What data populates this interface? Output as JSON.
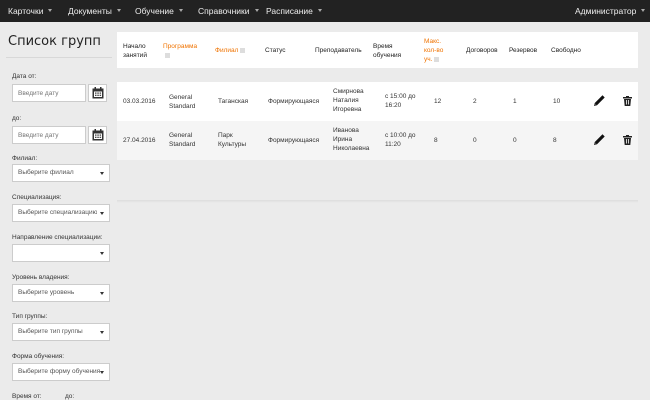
{
  "nav": {
    "items": [
      {
        "label": "Карточки"
      },
      {
        "label": "Документы"
      },
      {
        "label": "Обучение"
      },
      {
        "label": "Справочники"
      },
      {
        "label": "Расписание"
      }
    ],
    "user": "Администратор"
  },
  "sidebar": {
    "title": "Список групп",
    "date_from_label": "Дата от:",
    "date_from_placeholder": "Введите дату",
    "date_to_label": "до:",
    "date_to_placeholder": "Введите дату",
    "filters": [
      {
        "label": "Филиал:",
        "value": "Выберите филиал"
      },
      {
        "label": "Специализация:",
        "value": "Выберите специализацию"
      },
      {
        "label": "Направление специализации:",
        "value": ""
      },
      {
        "label": "Уровень владения:",
        "value": "Выберите уровень"
      },
      {
        "label": "Тип группы:",
        "value": "Выберите тип группы"
      },
      {
        "label": "Форма обучения:",
        "value": "Выберите форму обучения"
      }
    ],
    "time_from_label": "Время от:",
    "time_to_label": "до:"
  },
  "table": {
    "headers": {
      "start": [
        "Начало",
        "занятий"
      ],
      "program": "Программа",
      "branch": "Филиал",
      "status": "Статус",
      "teacher": "Преподаватель",
      "time": [
        "Время",
        "обучения"
      ],
      "max": [
        "Макс.",
        "кол-во",
        "уч."
      ],
      "contracts": "Договоров",
      "reserves": "Резервов",
      "free": "Свободно"
    },
    "rows": [
      {
        "start": "03.03.2016",
        "program": [
          "General",
          "Standard"
        ],
        "branch": [
          "Таганская"
        ],
        "status": "Формирующаяся",
        "teacher": [
          "Смирнова",
          "Наталия",
          "Игоревна"
        ],
        "time": [
          "с 15:00 до",
          "16:20"
        ],
        "max": "12",
        "contracts": "2",
        "reserves": "1",
        "free": "10"
      },
      {
        "start": "27.04.2016",
        "program": [
          "General",
          "Standard"
        ],
        "branch": [
          "Парк",
          "Культуры"
        ],
        "status": "Формирующаяся",
        "teacher": [
          "Иванова",
          "Ирина",
          "Николаевна"
        ],
        "time": [
          "с 10:00 до",
          "11:20"
        ],
        "max": "8",
        "contracts": "0",
        "reserves": "0",
        "free": "8"
      }
    ]
  },
  "colors": {
    "accent": "#f07300",
    "nav_bg": "#222222"
  }
}
